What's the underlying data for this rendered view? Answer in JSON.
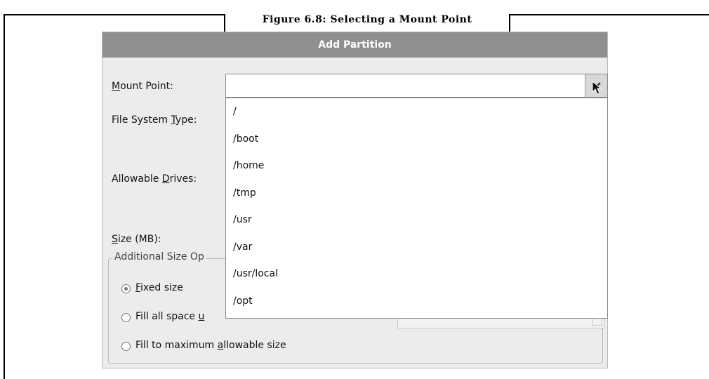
{
  "figure": {
    "caption": "Figure 6.8: Selecting a Mount Point"
  },
  "dialog": {
    "title": "Add Partition",
    "mount_point": {
      "label_u": "M",
      "label_rest": "ount Point:",
      "value": ""
    },
    "fs_type": {
      "label_pre": "File System ",
      "label_u": "T",
      "label_rest": "ype:"
    },
    "drives": {
      "label_pre": "Allowable ",
      "label_u": "D",
      "label_rest": "rives:"
    },
    "size": {
      "label_u": "S",
      "label_rest": "ize (MB):"
    },
    "additional_size": {
      "legend": "Additional Size Op",
      "options": [
        {
          "pre": "",
          "u": "F",
          "rest": "ixed size",
          "selected": true
        },
        {
          "pre": "Fill all space ",
          "u": "u",
          "rest": "",
          "selected": false
        },
        {
          "pre": "Fill to maximum ",
          "u": "a",
          "rest": "llowable size",
          "selected": false
        }
      ]
    }
  },
  "dropdown": {
    "items": [
      "/",
      "/boot",
      "/home",
      "/tmp",
      "/usr",
      "/var",
      "/usr/local",
      "/opt"
    ]
  }
}
